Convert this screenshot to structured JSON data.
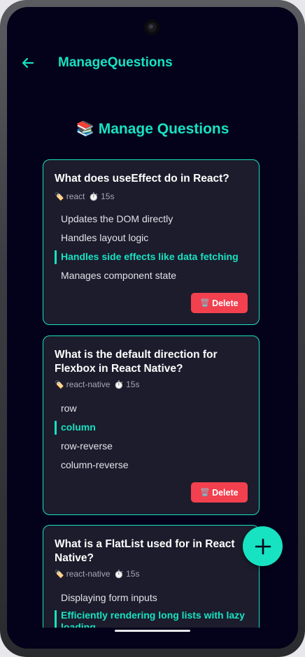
{
  "header": {
    "title": "ManageQuestions",
    "back_icon": "arrow-left-icon"
  },
  "page": {
    "heading_emoji": "📚",
    "heading": "Manage Questions"
  },
  "colors": {
    "accent": "#17e2c2",
    "background": "#03021a",
    "card": "#1c1c2c",
    "delete": "#f2404f"
  },
  "questions": [
    {
      "title": "What does useEffect do in React?",
      "tag_icon": "🏷️",
      "tag": "react",
      "timer_icon": "⏱️",
      "time": "15s",
      "options": [
        {
          "text": "Updates the DOM directly",
          "correct": false
        },
        {
          "text": "Handles layout logic",
          "correct": false
        },
        {
          "text": "Handles side effects like data fetching",
          "correct": true
        },
        {
          "text": "Manages component state",
          "correct": false
        }
      ],
      "delete_icon": "🗑️",
      "delete_label": "Delete"
    },
    {
      "title": "What is the default direction for Flexbox in React Native?",
      "tag_icon": "🏷️",
      "tag": "react-native",
      "timer_icon": "⏱️",
      "time": "15s",
      "options": [
        {
          "text": "row",
          "correct": false
        },
        {
          "text": "column",
          "correct": true
        },
        {
          "text": "row-reverse",
          "correct": false
        },
        {
          "text": "column-reverse",
          "correct": false
        }
      ],
      "delete_icon": "🗑️",
      "delete_label": "Delete"
    },
    {
      "title": "What is a FlatList used for in React Native?",
      "tag_icon": "🏷️",
      "tag": "react-native",
      "timer_icon": "⏱️",
      "time": "15s",
      "options": [
        {
          "text": "Displaying form inputs",
          "correct": false
        },
        {
          "text": "Efficiently rendering long lists with lazy loading",
          "correct": true
        }
      ]
    }
  ],
  "fab": {
    "icon": "plus-icon"
  }
}
